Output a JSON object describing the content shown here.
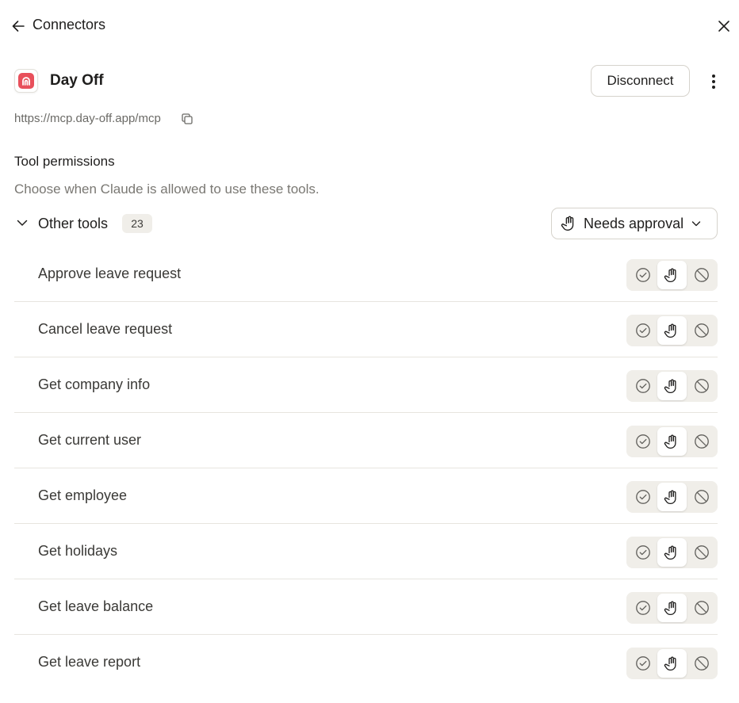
{
  "header": {
    "title": "Connectors",
    "back_icon": "arrow-left-icon",
    "close_icon": "close-icon"
  },
  "connector": {
    "name": "Day Off",
    "url": "https://mcp.day-off.app/mcp",
    "logo_color": "#e8505b",
    "disconnect_label": "Disconnect",
    "more_icon": "more-vertical-icon",
    "copy_icon": "copy-icon"
  },
  "permissions": {
    "title": "Tool permissions",
    "description": "Choose when Claude is allowed to use these tools.",
    "group": {
      "label": "Other tools",
      "count": "23",
      "expanded": true,
      "selected_policy": "Needs approval",
      "policy_icon": "hand-icon"
    },
    "tools": [
      {
        "name": "Approve leave request",
        "policy": "needs-approval"
      },
      {
        "name": "Cancel leave request",
        "policy": "needs-approval"
      },
      {
        "name": "Get company info",
        "policy": "needs-approval"
      },
      {
        "name": "Get current user",
        "policy": "needs-approval"
      },
      {
        "name": "Get employee",
        "policy": "needs-approval"
      },
      {
        "name": "Get holidays",
        "policy": "needs-approval"
      },
      {
        "name": "Get leave balance",
        "policy": "needs-approval"
      },
      {
        "name": "Get leave report",
        "policy": "needs-approval"
      }
    ]
  }
}
